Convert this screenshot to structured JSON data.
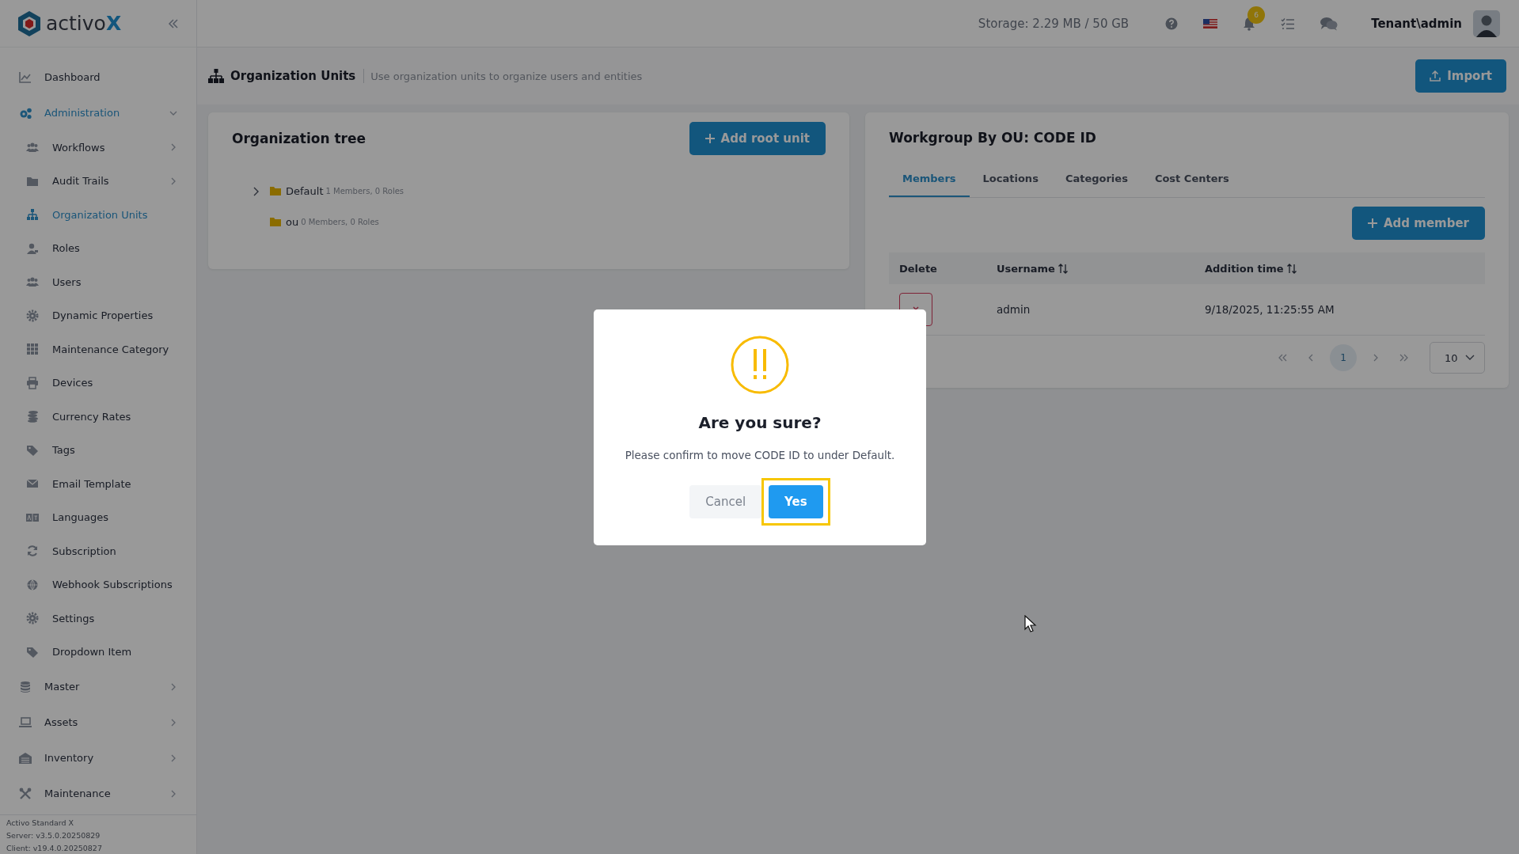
{
  "logo": {
    "name": "activo",
    "mark": "X"
  },
  "top_bar": {
    "storage": "Storage: 2.29 MB / 50 GB",
    "notifications_badge": "6",
    "user": "Tenant\\admin"
  },
  "sidebar": {
    "items": [
      {
        "label": "Dashboard",
        "selected": false,
        "expandable": false
      },
      {
        "label": "Administration",
        "selected": true,
        "expandable": true,
        "expanded": true,
        "children": [
          {
            "label": "Workflows",
            "selected": false,
            "expandable": true
          },
          {
            "label": "Audit Trails",
            "selected": false,
            "expandable": true
          },
          {
            "label": "Organization Units",
            "selected": true,
            "expandable": false
          },
          {
            "label": "Roles",
            "selected": false,
            "expandable": false
          },
          {
            "label": "Users",
            "selected": false,
            "expandable": false
          },
          {
            "label": "Dynamic Properties",
            "selected": false,
            "expandable": false
          },
          {
            "label": "Maintenance Category",
            "selected": false,
            "expandable": false
          },
          {
            "label": "Devices",
            "selected": false,
            "expandable": false
          },
          {
            "label": "Currency Rates",
            "selected": false,
            "expandable": false
          },
          {
            "label": "Tags",
            "selected": false,
            "expandable": false
          },
          {
            "label": "Email Template",
            "selected": false,
            "expandable": false
          },
          {
            "label": "Languages",
            "selected": false,
            "expandable": false
          },
          {
            "label": "Subscription",
            "selected": false,
            "expandable": false
          },
          {
            "label": "Webhook Subscriptions",
            "selected": false,
            "expandable": false
          },
          {
            "label": "Settings",
            "selected": false,
            "expandable": false
          },
          {
            "label": "Dropdown Item",
            "selected": false,
            "expandable": false
          }
        ]
      },
      {
        "label": "Master",
        "selected": false,
        "expandable": true,
        "expanded": false
      },
      {
        "label": "Assets",
        "selected": false,
        "expandable": true,
        "expanded": false
      },
      {
        "label": "Inventory",
        "selected": false,
        "expandable": true,
        "expanded": false
      },
      {
        "label": "Maintenance",
        "selected": false,
        "expandable": true,
        "expanded": false
      }
    ],
    "footer": [
      "Activo Standard X",
      "Server: v3.5.0.20250829",
      "Client: v19.4.0.20250827"
    ]
  },
  "page_header": {
    "title": "Organization Units",
    "subtitle": "Use organization units to organize users and entities",
    "import_button": "Import"
  },
  "org_tree": {
    "title": "Organization tree",
    "add_button": "Add root unit",
    "nodes": [
      {
        "name": "Default",
        "info": "1 Members, 0 Roles",
        "expandable": true
      },
      {
        "name": "ou",
        "info": "0 Members, 0 Roles",
        "expandable": false
      }
    ]
  },
  "workgroup": {
    "title": "Workgroup By OU: CODE ID",
    "tabs": [
      {
        "label": "Members",
        "selected": true
      },
      {
        "label": "Locations",
        "selected": false
      },
      {
        "label": "Categories",
        "selected": false
      },
      {
        "label": "Cost Centers",
        "selected": false
      }
    ],
    "add_button": "Add member",
    "table": {
      "columns": [
        {
          "label": "Delete",
          "sortable": false
        },
        {
          "label": "Username",
          "sortable": true
        },
        {
          "label": "Addition time",
          "sortable": true
        }
      ],
      "rows": [
        {
          "username": "admin",
          "addition_time": "9/18/2025, 11:25:55 AM"
        }
      ]
    },
    "pagination": {
      "pages": [
        {
          "label": "1",
          "selected": true
        }
      ],
      "page_size": "10"
    }
  },
  "dialog": {
    "title": "Are you sure?",
    "message": "Please confirm to move CODE ID to under Default.",
    "buttons": [
      {
        "label": "Cancel",
        "kind": "secondary",
        "highlighted": false
      },
      {
        "label": "Yes",
        "kind": "primary",
        "highlighted": true
      }
    ]
  }
}
